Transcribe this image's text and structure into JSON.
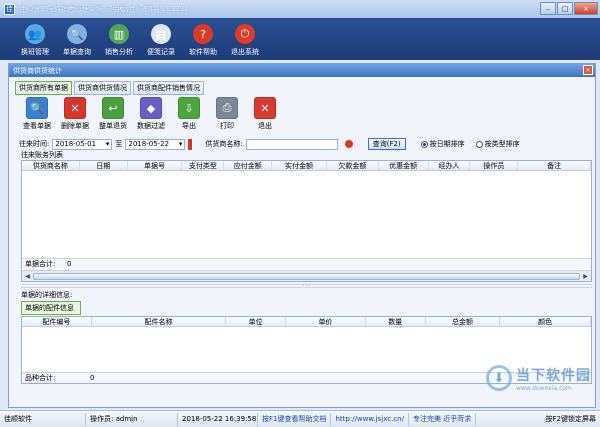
{
  "window": {
    "title": "佳顺汽车配件销售管理系统 试用版[佳顺软件] 2013V1",
    "app_icon": "佳",
    "min": "–",
    "max": "□",
    "close": "×"
  },
  "toolbar": [
    {
      "label": "换班管理",
      "icon": "people-icon",
      "color": "#5aa8e0",
      "glyph": "👥"
    },
    {
      "label": "单据查询",
      "icon": "magnifier-icon",
      "color": "#7fb3e8",
      "glyph": "🔍"
    },
    {
      "label": "销售分析",
      "icon": "chart-icon",
      "color": "#4fa65a",
      "glyph": "▥"
    },
    {
      "label": "便笺记录",
      "icon": "notepad-icon",
      "color": "#e0e6ef",
      "glyph": "▤"
    },
    {
      "label": "软件帮助",
      "icon": "help-icon",
      "color": "#d93a2b",
      "glyph": "?"
    },
    {
      "label": "退出系统",
      "icon": "power-icon",
      "color": "#e03a2a",
      "glyph": "⏻"
    }
  ],
  "child": {
    "title": "供货商供货统计",
    "close": "×"
  },
  "tabs": [
    "供货商所有单据",
    "供货商供货情况",
    "供货商配件销售情况"
  ],
  "subtools": [
    {
      "label": "查看单据",
      "icon": "view-doc-icon",
      "color": "#3b7fd1",
      "glyph": "🔍"
    },
    {
      "label": "删除单据",
      "icon": "delete-icon",
      "color": "#d9342b",
      "glyph": "✕"
    },
    {
      "label": "整单退货",
      "icon": "return-icon",
      "color": "#4c9f3e",
      "glyph": "↩"
    },
    {
      "label": "数据过滤",
      "icon": "filter-icon",
      "color": "#6a5fc8",
      "glyph": "◆"
    },
    {
      "label": "导出",
      "icon": "export-icon",
      "color": "#4ca540",
      "glyph": "⇩"
    },
    {
      "label": "打印",
      "icon": "printer-icon",
      "color": "#7a8796",
      "glyph": "⎙"
    },
    {
      "label": "退出",
      "icon": "exit-icon",
      "color": "#d8392c",
      "glyph": "✕"
    }
  ],
  "filter": {
    "date_label": "往来时间:",
    "date_from": "2018-05-01",
    "to": "至",
    "date_to": "2018-05-22",
    "supplier_label": "供货商名称:",
    "supplier_value": "",
    "query": "查询(F2)",
    "radio1": "按日期排序",
    "radio2": "按类型排序"
  },
  "grid1": {
    "caption": "往来账务列表",
    "columns": [
      "供货商名称",
      "日期",
      "单据号",
      "支付类型",
      "应付金额",
      "实付金额",
      "欠款金额",
      "优惠金额",
      "经办人",
      "操作员",
      "备注"
    ],
    "footer_label": "单据合计:",
    "footer_value": "0"
  },
  "detail": {
    "caption": "单据的详细信息:",
    "tab": "单据的配件信息"
  },
  "grid2": {
    "columns": [
      "配件编号",
      "配件名称",
      "单位",
      "单价",
      "数量",
      "总金额",
      "颜色"
    ],
    "footer_label": "品种合计:",
    "footer_value": "0"
  },
  "status": {
    "company": "佳顺软件",
    "operator": "操作员: admin",
    "datetime": "2018-05-22 16:39:58",
    "help": "按F1键查看帮助文档",
    "url": "http://www.jsjxc.cn/",
    "slogan": "专注完美 近乎苛求",
    "lock": "按F2键锁定屏幕"
  },
  "watermark": {
    "big": "当下软件园",
    "small": "www.downxia.com"
  }
}
